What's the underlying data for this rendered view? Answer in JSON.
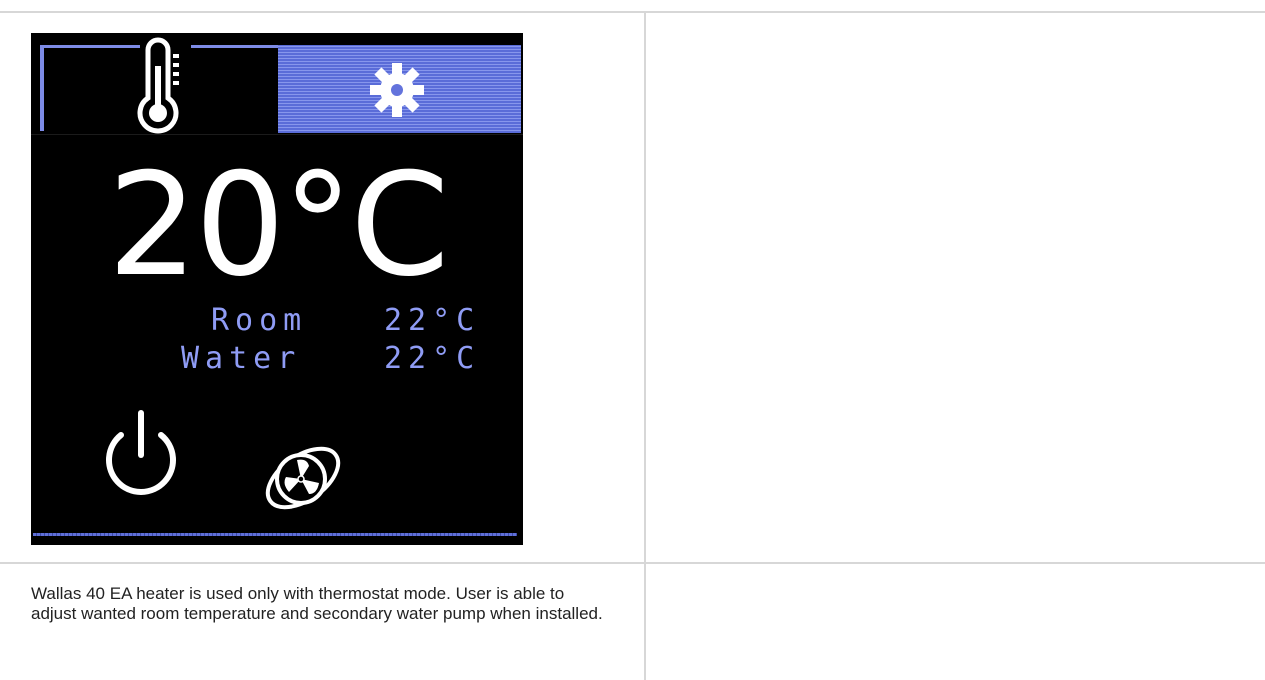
{
  "display": {
    "setpoint": "20°C",
    "readings": [
      {
        "label": "Room",
        "value": "22°C"
      },
      {
        "label": "Water",
        "value": "22°C"
      }
    ],
    "tabs": [
      {
        "icon": "thermometer-icon",
        "selected": true
      },
      {
        "icon": "gear-icon",
        "selected": false
      }
    ],
    "controls": [
      {
        "icon": "power-icon"
      },
      {
        "icon": "fan-icon"
      }
    ],
    "colors": {
      "screen_background": "#000000",
      "text_primary": "#ffffff",
      "text_secondary": "#8f9cf5",
      "tab_highlight": "#6f7fe4"
    }
  },
  "caption": {
    "text": "Wallas 40 EA heater is used only with thermostat mode. User is able to adjust wanted room temperature and secondary water pump when installed."
  }
}
